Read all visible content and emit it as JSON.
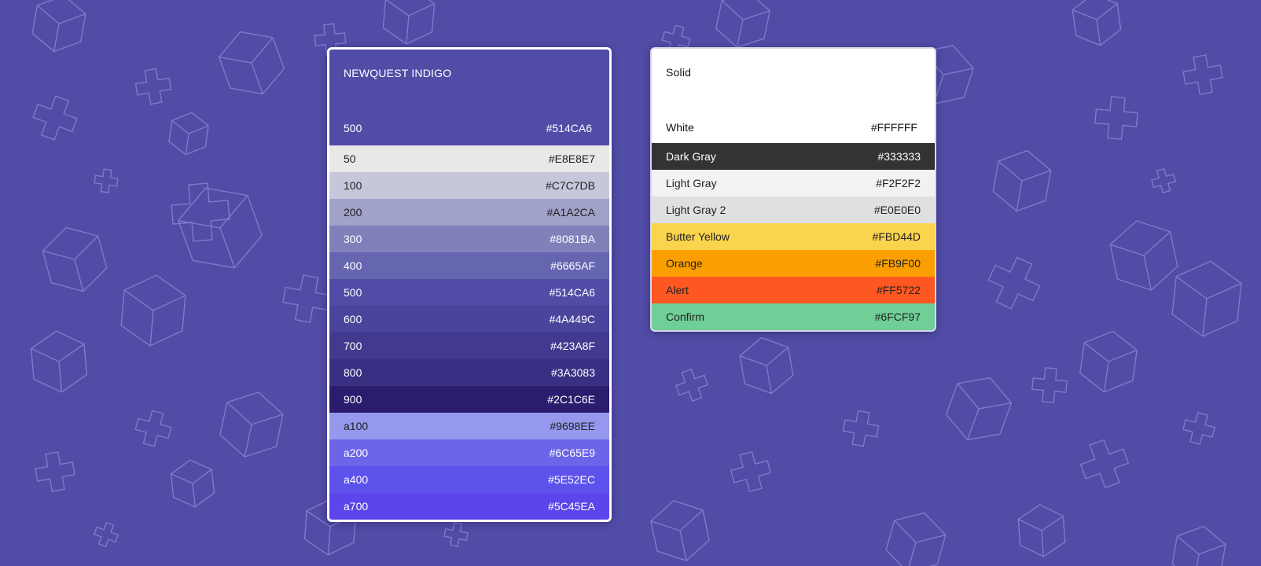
{
  "indigo_card": {
    "title": "NEWQUEST INDIGO",
    "header_swatch": {
      "name": "500",
      "hex": "#514CA6"
    },
    "swatches": [
      {
        "name": "50",
        "hex": "#E8E8E7",
        "bg": "#E8E8E7",
        "fg": "#222222"
      },
      {
        "name": "100",
        "hex": "#C7C7DB",
        "bg": "#C7C7DB",
        "fg": "#222222"
      },
      {
        "name": "200",
        "hex": "#A1A2CA",
        "bg": "#A1A2CA",
        "fg": "#222222"
      },
      {
        "name": "300",
        "hex": "#8081BA",
        "bg": "#8081BA",
        "fg": "#FFFFFF"
      },
      {
        "name": "400",
        "hex": "#6665AF",
        "bg": "#6665AF",
        "fg": "#FFFFFF"
      },
      {
        "name": "500",
        "hex": "#514CA6",
        "bg": "#514CA6",
        "fg": "#FFFFFF"
      },
      {
        "name": "600",
        "hex": "#4A449C",
        "bg": "#4A449C",
        "fg": "#FFFFFF"
      },
      {
        "name": "700",
        "hex": "#423A8F",
        "bg": "#423A8F",
        "fg": "#FFFFFF"
      },
      {
        "name": "800",
        "hex": "#3A3083",
        "bg": "#3A3083",
        "fg": "#FFFFFF"
      },
      {
        "name": "900",
        "hex": "#2C1C6E",
        "bg": "#2C1C6E",
        "fg": "#FFFFFF"
      },
      {
        "name": "a100",
        "hex": "#9698EE",
        "bg": "#9698EE",
        "fg": "#222222"
      },
      {
        "name": "a200",
        "hex": "#6C65E9",
        "bg": "#6C65E9",
        "fg": "#FFFFFF"
      },
      {
        "name": "a400",
        "hex": "#5E52EC",
        "bg": "#5E52EC",
        "fg": "#FFFFFF"
      },
      {
        "name": "a700",
        "hex": "#5C45EA",
        "bg": "#5C45EA",
        "fg": "#FFFFFF"
      }
    ]
  },
  "solid_card": {
    "title": "Solid",
    "header_swatch": {
      "name": "White",
      "hex": "#FFFFFF"
    },
    "swatches": [
      {
        "name": "Dark Gray",
        "hex": "#333333",
        "bg": "#333333",
        "fg": "#FFFFFF"
      },
      {
        "name": "Light Gray",
        "hex": "#F2F2F2",
        "bg": "#F2F2F2",
        "fg": "#222222"
      },
      {
        "name": "Light Gray 2",
        "hex": "#E0E0E0",
        "bg": "#E0E0E0",
        "fg": "#222222"
      },
      {
        "name": "Butter Yellow",
        "hex": "#FBD44D",
        "bg": "#FBD44D",
        "fg": "#222222"
      },
      {
        "name": "Orange",
        "hex": "#FB9F00",
        "bg": "#FB9F00",
        "fg": "#222222"
      },
      {
        "name": "Alert",
        "hex": "#FF5722",
        "bg": "#FF5722",
        "fg": "#222222"
      },
      {
        "name": "Confirm",
        "hex": "#6FCF97",
        "bg": "#6FCF97",
        "fg": "#222222"
      }
    ]
  },
  "colors": {
    "background": "#514CA6",
    "pattern_stroke": "#8E8AD6"
  }
}
